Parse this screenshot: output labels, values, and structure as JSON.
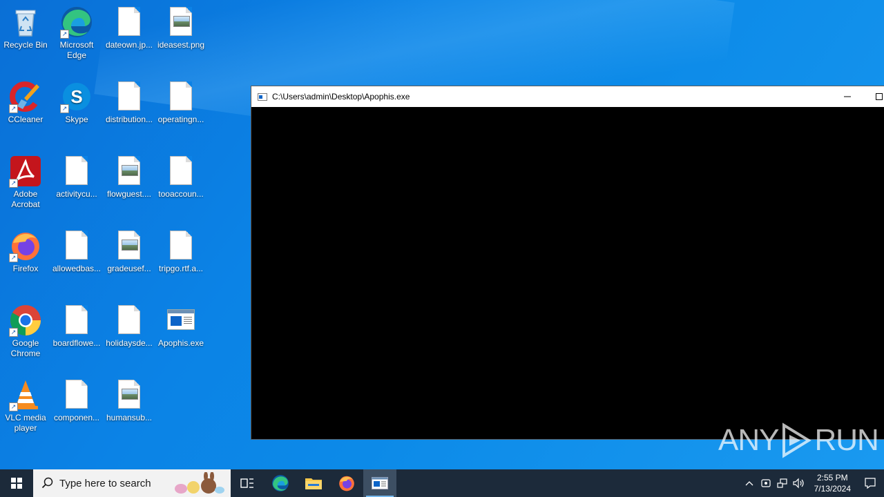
{
  "desktop_icons": [
    {
      "label": "Recycle Bin",
      "icon": "recycle-bin-icon"
    },
    {
      "label": "Microsoft Edge",
      "icon": "edge-icon"
    },
    {
      "label": "dateown.jp...",
      "icon": "file-icon"
    },
    {
      "label": "ideasest.png",
      "icon": "image-file-icon"
    },
    {
      "label": "CCleaner",
      "icon": "ccleaner-icon"
    },
    {
      "label": "Skype",
      "icon": "skype-icon"
    },
    {
      "label": "distribution...",
      "icon": "file-icon"
    },
    {
      "label": "operatingn...",
      "icon": "file-icon"
    },
    {
      "label": "Adobe Acrobat",
      "icon": "acrobat-icon"
    },
    {
      "label": "activitycu...",
      "icon": "file-icon"
    },
    {
      "label": "flowguest....",
      "icon": "image-file-icon"
    },
    {
      "label": "tooaccoun...",
      "icon": "file-icon"
    },
    {
      "label": "Firefox",
      "icon": "firefox-icon"
    },
    {
      "label": "allowedbas...",
      "icon": "file-icon"
    },
    {
      "label": "gradeusef...",
      "icon": "image-file-icon"
    },
    {
      "label": "tripgo.rtf.a...",
      "icon": "file-icon"
    },
    {
      "label": "Google Chrome",
      "icon": "chrome-icon"
    },
    {
      "label": "boardflowe...",
      "icon": "file-icon"
    },
    {
      "label": "holidaysde...",
      "icon": "file-icon"
    },
    {
      "label": "Apophis.exe",
      "icon": "exe-icon"
    },
    {
      "label": "VLC media player",
      "icon": "vlc-icon"
    },
    {
      "label": "componen...",
      "icon": "file-icon"
    },
    {
      "label": "humansub...",
      "icon": "image-file-icon"
    }
  ],
  "console_window": {
    "title": "C:\\Users\\admin\\Desktop\\Apophis.exe",
    "minimize_glyph": "—",
    "maximize_glyph": "☐"
  },
  "watermark": {
    "left": "ANY",
    "right": "RUN"
  },
  "taskbar": {
    "search_placeholder": "Type here to search",
    "pinned": [
      "task-view-icon",
      "edge-icon",
      "file-explorer-icon",
      "firefox-icon",
      "console-app-icon"
    ],
    "tray": {
      "time": "2:55 PM",
      "date": "7/13/2024"
    }
  },
  "colors": {
    "desktop_blue": "#0b83e6",
    "taskbar": "#1c2a3a",
    "console_bg": "#000000"
  }
}
